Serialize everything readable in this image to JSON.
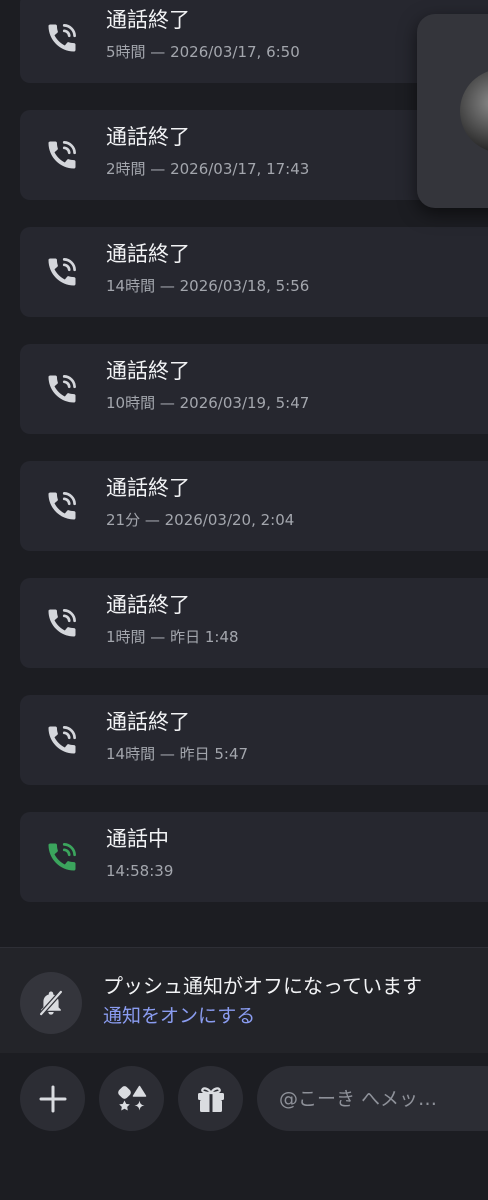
{
  "calls": [
    {
      "title": "通話終了",
      "subtitle": "5時間 — 2026/03/17, 6:50",
      "status": "ended"
    },
    {
      "title": "通話終了",
      "subtitle": "2時間 — 2026/03/17, 17:43",
      "status": "ended"
    },
    {
      "title": "通話終了",
      "subtitle": "14時間 — 2026/03/18, 5:56",
      "status": "ended"
    },
    {
      "title": "通話終了",
      "subtitle": "10時間 — 2026/03/19, 5:47",
      "status": "ended"
    },
    {
      "title": "通話終了",
      "subtitle": "21分 — 2026/03/20, 2:04",
      "status": "ended"
    },
    {
      "title": "通話終了",
      "subtitle": "1時間 — 昨日 1:48",
      "status": "ended"
    },
    {
      "title": "通話終了",
      "subtitle": "14時間 — 昨日 5:47",
      "status": "ended"
    },
    {
      "title": "通話中",
      "subtitle": "14:58:39",
      "status": "active"
    }
  ],
  "colors": {
    "ended_icon": "#d4d6db",
    "active_icon": "#3ba55d",
    "link": "#8a9cf0"
  },
  "notification": {
    "message": "プッシュ通知がオフになっています",
    "link_label": "通知をオンにする",
    "icon": "bell-slash-icon"
  },
  "composer": {
    "placeholder": "@こーき へメッ…",
    "buttons": [
      {
        "name": "add-button",
        "icon": "plus-icon"
      },
      {
        "name": "apps-button",
        "icon": "apps-icon"
      },
      {
        "name": "gift-button",
        "icon": "gift-icon"
      }
    ]
  }
}
